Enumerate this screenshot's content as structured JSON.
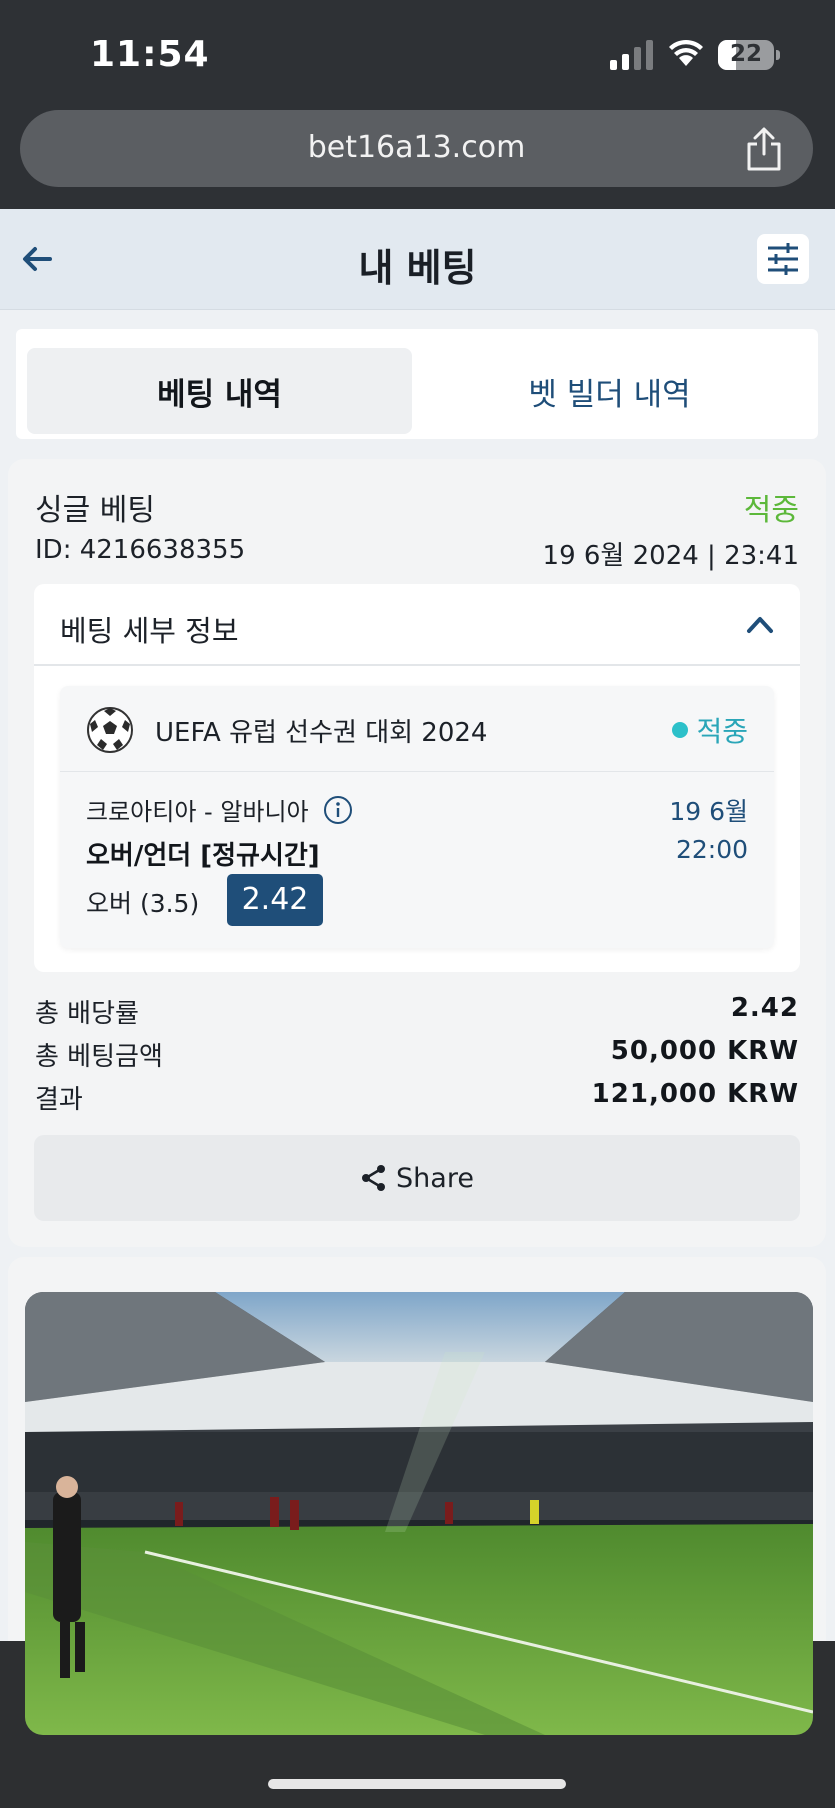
{
  "status_bar": {
    "time": "11:54",
    "battery": "22"
  },
  "browser": {
    "url": "bet16a13.com"
  },
  "header": {
    "title": "내 베팅"
  },
  "tabs": [
    {
      "label": "베팅 내역",
      "active": true
    },
    {
      "label": "벳 빌더 내역",
      "active": false
    }
  ],
  "bet": {
    "type": "싱글 베팅",
    "status": "적중",
    "id": "ID: 4216638355",
    "datetime": "19 6월 2024 | 23:41",
    "details_title": "베팅 세부 정보",
    "selection": {
      "league": "UEFA 유럽 선수권 대회 2024",
      "status": "적중",
      "match": "크로아티아 - 알바니아",
      "match_date": "19 6월",
      "market": "오버/언더 [정규시간]",
      "match_time": "22:00",
      "pick": "오버 (3.5)",
      "odds": "2.42"
    },
    "summary": [
      {
        "label": "총 배당률",
        "value": "2.42"
      },
      {
        "label": "총 베팅금액",
        "value": "50,000 KRW"
      },
      {
        "label": "결과",
        "value": "121,000 KRW"
      }
    ],
    "share_label": "Share"
  },
  "colors": {
    "accent": "#1f4e79",
    "win_green": "#5cb83a",
    "win_teal": "#2aa6b8"
  }
}
